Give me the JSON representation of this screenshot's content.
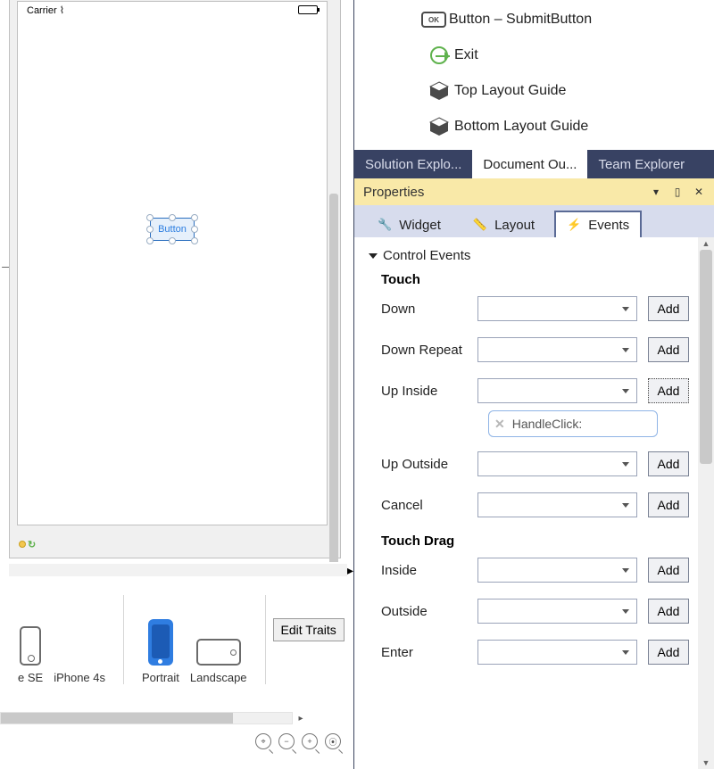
{
  "designer": {
    "status_carrier": "Carrier",
    "button_text": "Button",
    "devices": [
      "e SE",
      "iPhone 4s"
    ],
    "orientations": {
      "portrait": "Portrait",
      "landscape": "Landscape"
    },
    "edit_traits": "Edit Traits"
  },
  "outline": {
    "rows": [
      {
        "icon": "ok",
        "label": "Button  –  SubmitButton"
      },
      {
        "icon": "exit",
        "label": "Exit"
      },
      {
        "icon": "cube",
        "label": "Top Layout Guide"
      },
      {
        "icon": "cube",
        "label": "Bottom Layout Guide"
      }
    ]
  },
  "explorer_tabs": {
    "solution": "Solution Explo...",
    "document": "Document Ou...",
    "team": "Team Explorer"
  },
  "properties": {
    "title": "Properties",
    "tabs": {
      "widget": "Widget",
      "layout": "Layout",
      "events": "Events"
    },
    "section": "Control Events",
    "groups": {
      "touch": {
        "label": "Touch",
        "events": [
          "Down",
          "Down Repeat",
          "Up Inside",
          "Up Outside",
          "Cancel"
        ]
      },
      "touch_drag": {
        "label": "Touch Drag",
        "events": [
          "Inside",
          "Outside",
          "Enter"
        ]
      }
    },
    "add_label": "Add",
    "handler_tag": "HandleClick:"
  }
}
